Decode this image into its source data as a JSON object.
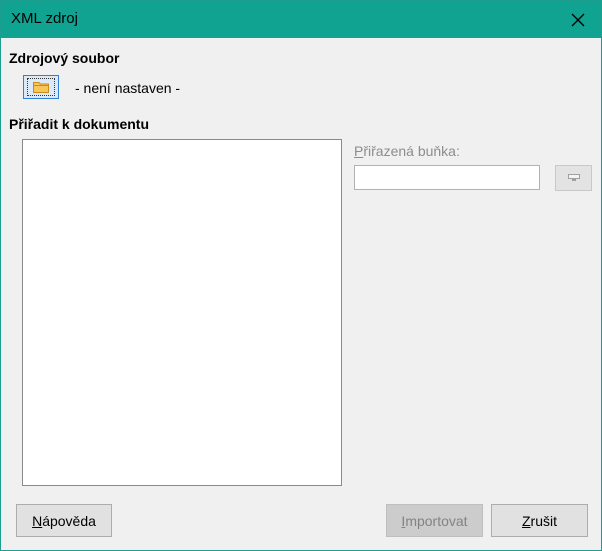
{
  "window": {
    "title": "XML zdroj",
    "close_icon": "close-icon",
    "titlebar_color": "#10a391"
  },
  "source": {
    "heading": "Zdrojový soubor",
    "browse_icon": "folder-icon",
    "status": "- není nastaven -"
  },
  "map": {
    "heading": "Přiřadit k dokumentu",
    "mapped_cell_label_mnemonic": "P",
    "mapped_cell_label_rest": "řiřazená buňka:",
    "mapped_cell_value": "",
    "shrink_icon": "shrink-icon"
  },
  "buttons": {
    "help_mnemonic": "N",
    "help_rest": "ápověda",
    "import_mnemonic": "I",
    "import_rest": "mportovat",
    "cancel_mnemonic": "Z",
    "cancel_rest": "rušit"
  }
}
